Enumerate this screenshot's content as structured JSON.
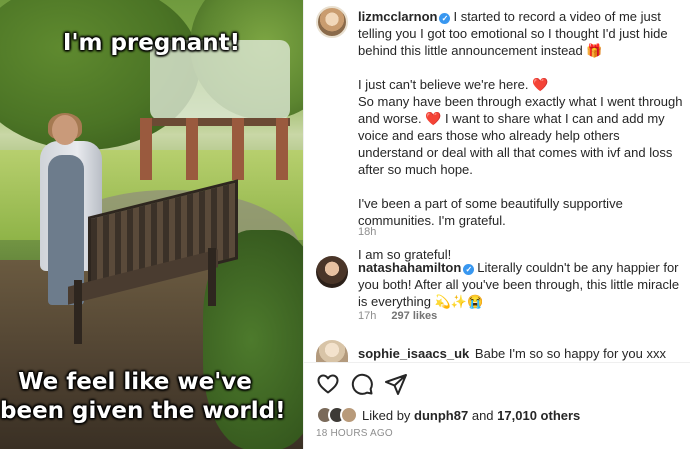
{
  "media": {
    "caption_top": "I'm pregnant!",
    "caption_bottom_line1": "We feel like we've",
    "caption_bottom_line2": "been given the world!"
  },
  "post": {
    "author": "lizmcclarnon",
    "verified_icon": "verified-badge-icon",
    "caption_line1": "I started to record a video of me just telling you I got too emotional so I thought I'd just hide behind this little announcement instead 🎁",
    "caption_p2": "I just can't believe we're here. ❤️",
    "caption_p3a": "So many have been through exactly what I went through and worse. ❤️ I want to share what I can and add my voice and ears those who already help others understand or deal with all that comes with ivf and loss after so much hope.",
    "caption_p4": "I've been a part of some beautifully supportive communities. I'm grateful.",
    "caption_p5": "I am so grateful!",
    "time": "18h"
  },
  "comments": [
    {
      "username": "natashahamilton",
      "text": "Literally couldn't be any happier for you both! After all you've been through, this little miracle is everything 💫✨😭",
      "time": "17h",
      "likes": "297 likes"
    },
    {
      "username": "sophie_isaacs_uk",
      "text": "Babe I'm so so happy for you xxx"
    }
  ],
  "actions": {
    "like_icon": "heart-icon",
    "comment_icon": "comment-icon",
    "share_icon": "share-icon"
  },
  "liked_by": {
    "prefix": "Liked by",
    "user": "dunph87",
    "connector": "and",
    "others": "17,010 others"
  },
  "timestamp": "18 HOURS AGO"
}
